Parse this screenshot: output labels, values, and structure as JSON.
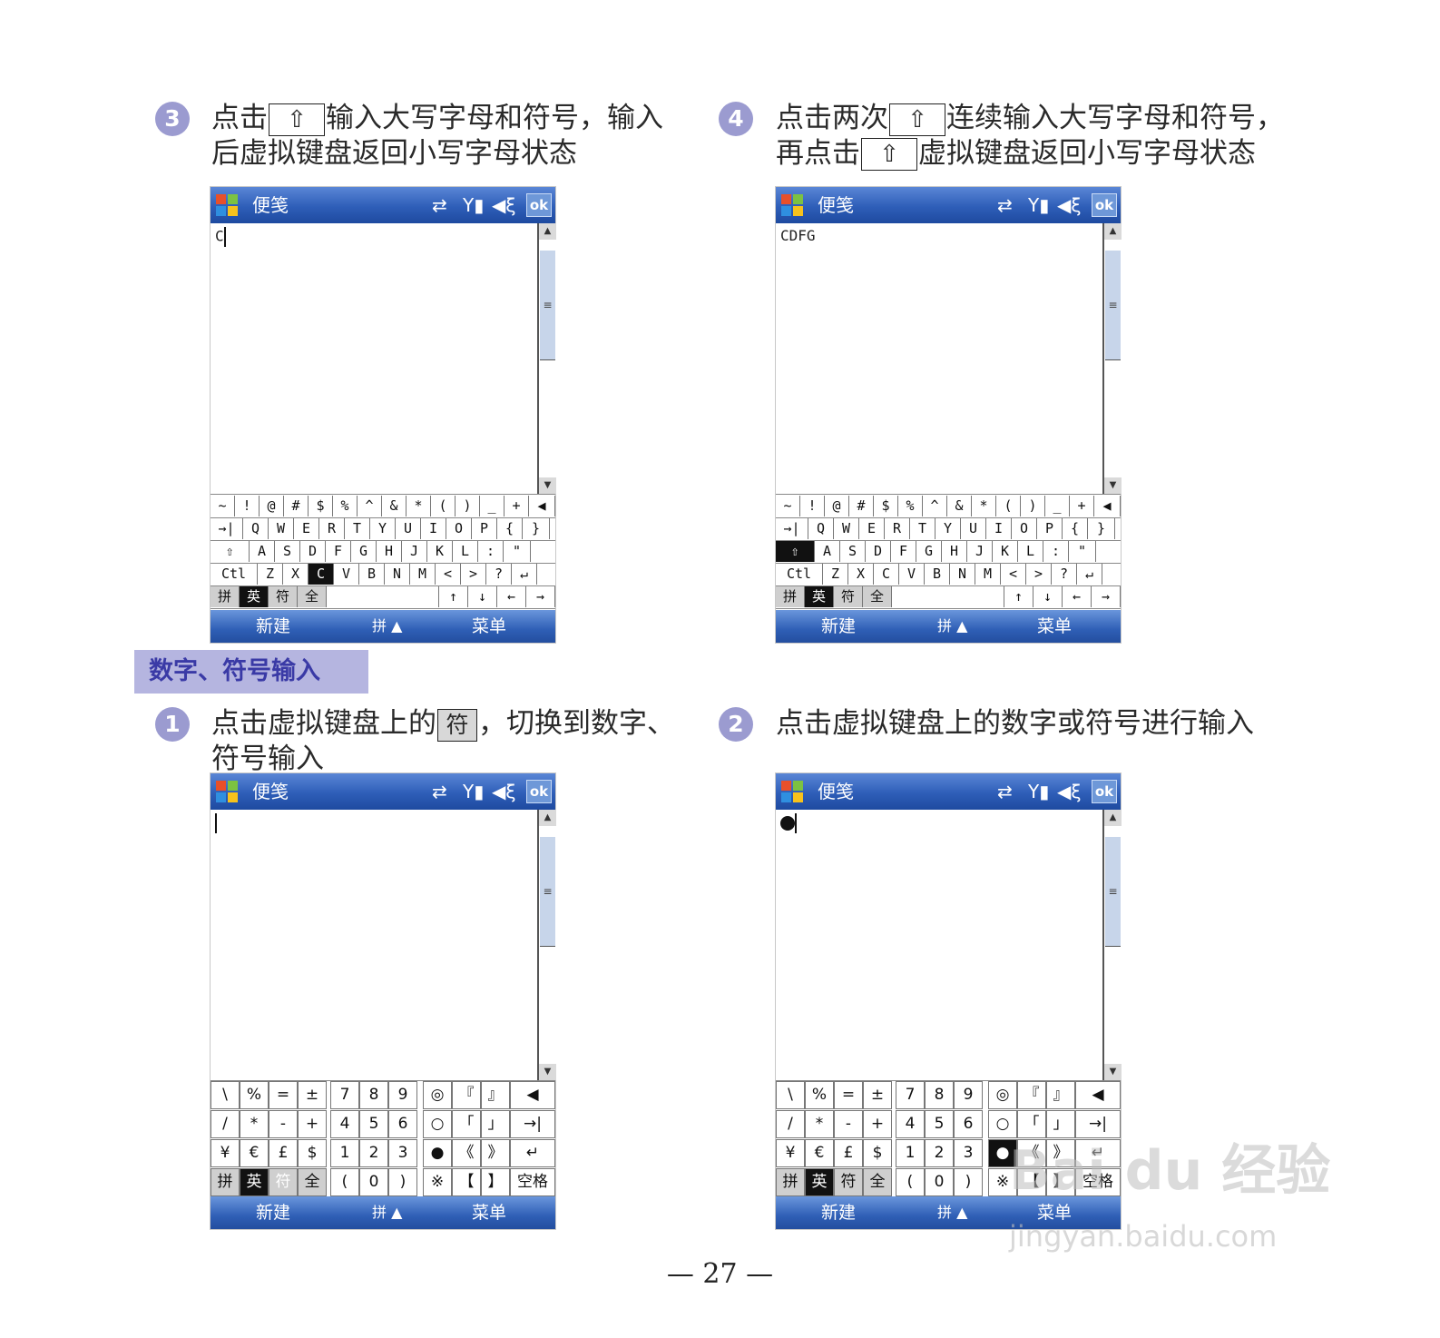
{
  "steps": {
    "s3": {
      "num": "3",
      "line1_a": "点击",
      "line1_b": "输入大写字母和符号，输入",
      "line2": "后虚拟键盘返回小写字母状态"
    },
    "s4": {
      "num": "4",
      "line1_a": "点击两次",
      "line1_b": "连续输入大写字母和符号，",
      "line2_a": "再点击",
      "line2_b": "虚拟键盘返回小写字母状态"
    },
    "s1": {
      "num": "1",
      "line1_a": "点击虚拟键盘上的",
      "line1_b": "，切换到数字、",
      "line2": "符号输入"
    },
    "s2": {
      "num": "2",
      "line1": "点击虚拟键盘上的数字或符号进行输入"
    }
  },
  "inline_keys": {
    "shift": "⇧",
    "fu": "符"
  },
  "section_title": "数字、符号输入",
  "device": {
    "app_title": "便笺",
    "status_icons": {
      "sync": "⇄",
      "signal": "Y▮",
      "volume": "◀ξ"
    },
    "ok_label": "ok",
    "softkeys": {
      "left": "新建",
      "middle": "拼 ▲",
      "right": "菜单"
    },
    "scroll_grip": "≡",
    "scroll_up": "▲",
    "scroll_down": "▼"
  },
  "screens": {
    "s3_text": "C",
    "s4_text": "CDFG"
  },
  "qwerty_rows": [
    [
      "~",
      "!",
      "@",
      "#",
      "$",
      "%",
      "^",
      "&",
      "*",
      "(",
      ")",
      "_",
      "+",
      "◀"
    ],
    [
      "→|",
      "Q",
      "W",
      "E",
      "R",
      "T",
      "Y",
      "U",
      "I",
      "O",
      "P",
      "{",
      "}"
    ],
    [
      "⇧",
      "A",
      "S",
      "D",
      "F",
      "G",
      "H",
      "J",
      "K",
      "L",
      ":",
      "\""
    ],
    [
      "Ctl",
      "Z",
      "X",
      "C",
      "V",
      "B",
      "N",
      "M",
      "<",
      ">",
      "?",
      "↵"
    ],
    [
      "拼",
      "英",
      "符",
      "全",
      "",
      "↑",
      "↓",
      "←",
      "→"
    ]
  ],
  "numpad": [
    [
      "\\",
      "%",
      "=",
      "±",
      "7",
      "8",
      "9",
      "◎",
      "『",
      "』",
      "◀"
    ],
    [
      "/",
      "*",
      "-",
      "+",
      "4",
      "5",
      "6",
      "○",
      "「",
      "」",
      "→|"
    ],
    [
      "¥",
      "€",
      "£",
      "$",
      "1",
      "2",
      "3",
      "●",
      "《",
      "》",
      "↵"
    ],
    [
      "拼",
      "英",
      "符",
      "全",
      "(",
      "0",
      ")",
      "※",
      "【",
      "】",
      "空格"
    ]
  ],
  "page_number": "— 27 —",
  "watermark": {
    "brand": "Bai du 经验",
    "url": "jingyan.baidu.com"
  }
}
